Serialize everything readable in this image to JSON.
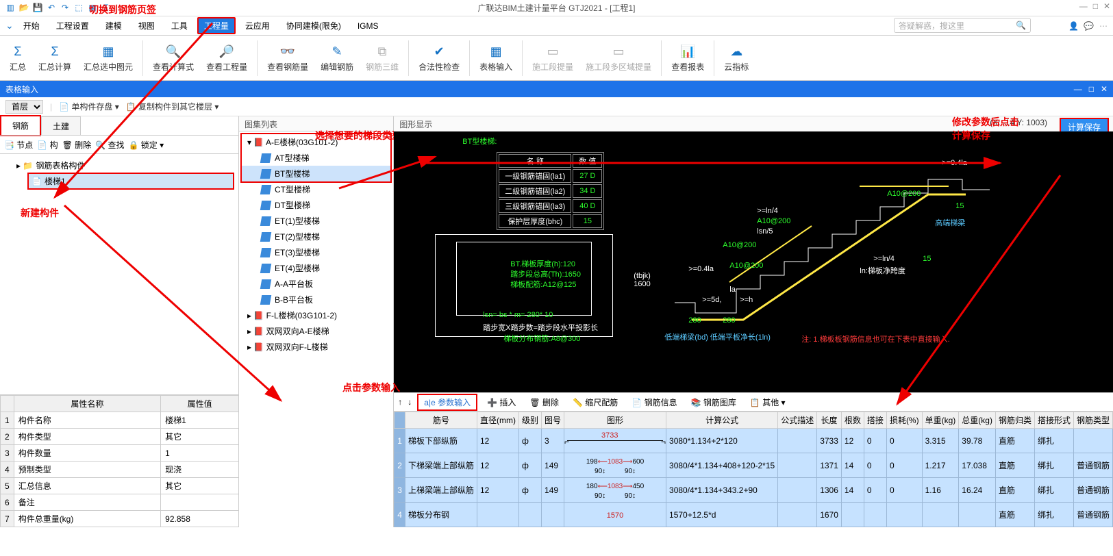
{
  "app": {
    "title": "广联达BIM土建计量平台 GTJ2021 - [工程1]"
  },
  "search": {
    "placeholder": "答疑解惑，搜这里"
  },
  "menu": [
    "开始",
    "工程设置",
    "建模",
    "视图",
    "工具",
    "工程量",
    "云应用",
    "协同建模(限免)",
    "IGMS"
  ],
  "menuActive": 5,
  "ribbon": [
    {
      "label": "汇总",
      "icon": "Σ"
    },
    {
      "label": "汇总计算",
      "icon": "Σ"
    },
    {
      "label": "汇总选中图元",
      "icon": "▦"
    },
    {
      "label": "查看计算式",
      "icon": "🔍"
    },
    {
      "label": "查看工程量",
      "icon": "📄"
    },
    {
      "label": "查看钢筋量",
      "icon": "⌗"
    },
    {
      "label": "编辑钢筋",
      "icon": "✎"
    },
    {
      "label": "钢筋三维",
      "icon": "⧉",
      "disabled": true
    },
    {
      "label": "合法性检查",
      "icon": "✔"
    },
    {
      "label": "表格输入",
      "icon": "▦"
    },
    {
      "label": "施工段提量",
      "icon": "▭",
      "disabled": true
    },
    {
      "label": "施工段多区域提量",
      "icon": "▭",
      "disabled": true
    },
    {
      "label": "查看报表",
      "icon": "📊"
    },
    {
      "label": "云指标",
      "icon": "☁"
    }
  ],
  "blueHeader": "表格输入",
  "toolbar2": {
    "floor": "首层",
    "b1": "单构件存盘 ▾",
    "b2": "复制构件到其它楼层 ▾"
  },
  "tabs": {
    "t1": "钢筋",
    "t2": "土建"
  },
  "leftToolbar": [
    "节点",
    "构",
    "删除",
    "查找",
    "锁定 ▾"
  ],
  "tree": {
    "root": "钢筋表格构件",
    "leaf": "楼梯1"
  },
  "annotations": {
    "switchTab": "切换到钢筋页签",
    "newComp": "新建构件",
    "chooseType": "选择想要的梯段类型",
    "clickParam": "点击参数输入",
    "modifySave": "修改参数后点击\n计算保存"
  },
  "midTitle": "图集列表",
  "midList": {
    "group1": "A-E楼梯(03G101-2)",
    "items1": [
      "AT型楼梯",
      "BT型楼梯",
      "CT型楼梯",
      "DT型楼梯",
      "ET(1)型楼梯",
      "ET(2)型楼梯",
      "ET(3)型楼梯",
      "ET(4)型楼梯",
      "A-A平台板",
      "B-B平台板"
    ],
    "group2": "F-L楼梯(03G101-2)",
    "group3": "双网双向A-E楼梯",
    "group4": "双网双向F-L楼梯"
  },
  "rightTitle": "图形显示",
  "coords": "(X: -14 Y: 1003)",
  "calcBtn": "计算保存",
  "diagram": {
    "title": "BT型楼梯:",
    "paramHeaders": [
      "名 称",
      "数 值"
    ],
    "params": [
      [
        "一级钢筋锚固(la1)",
        "27 D"
      ],
      [
        "二级钢筋锚固(la2)",
        "34 D"
      ],
      [
        "三级钢筋锚固(la3)",
        "40 D"
      ],
      [
        "保护层厚度(bhc)",
        "15"
      ]
    ],
    "bt_h": "BT.梯板厚度(h):120",
    "stepTotal": "踏步段总高(Th):1650",
    "stairBar": "梯板配筋:A12@125",
    "lsn": "lsn= bs * m= 280* 10",
    "stepFormula": "踏步宽X踏步数=踏步段水平投影长",
    "distBar": "梯板分布钢筋:A8@300",
    "tbjk": "(tbjk)\n1600",
    "a10_200": "A10@200",
    "lsn5": "lsn/5",
    "ln4": ">=ln/4",
    "highBeam": "高端梯梁",
    "lowBeam": "低端梯梁(bd) 低端平板净长(1ln)",
    "stairNet": "ln:梯板净跨度",
    "note": "注: 1.梯板板钢筋信息也可在下表中直接输入.",
    "la": "la",
    "h": ">=h",
    "d5": ">=5d,",
    "d04": ">=0.4la",
    "v280": "280",
    "v15": "15"
  },
  "propHeaders": [
    "属性名称",
    "属性值"
  ],
  "props": [
    [
      "构件名称",
      "楼梯1"
    ],
    [
      "构件类型",
      "其它"
    ],
    [
      "构件数量",
      "1"
    ],
    [
      "预制类型",
      "现浇"
    ],
    [
      "汇总信息",
      "其它"
    ],
    [
      "备注",
      ""
    ],
    [
      "构件总重量(kg)",
      "92.858"
    ]
  ],
  "rebarToolbar": {
    "param": "参数输入",
    "items": [
      "插入",
      "删除",
      "缩尺配筋",
      "钢筋信息",
      "钢筋图库",
      "其他 ▾"
    ]
  },
  "rebarHeaders": [
    "筋号",
    "直径(mm)",
    "级别",
    "图号",
    "图形",
    "计算公式",
    "公式描述",
    "长度",
    "根数",
    "搭接",
    "损耗(%)",
    "单重(kg)",
    "总重(kg)",
    "钢筋归类",
    "搭接形式",
    "钢筋类型"
  ],
  "rebarRows": [
    {
      "n": "1",
      "name": "梯板下部纵筋",
      "d": "12",
      "lv": "ф",
      "fig": "3",
      "shape": "3733",
      "formula": "3080*1.134+2*120",
      "desc": "",
      "len": "3733",
      "cnt": "12",
      "lap": "0",
      "loss": "0",
      "uw": "3.315",
      "tw": "39.78",
      "cls": "直筋",
      "form": "绑扎",
      "type": ""
    },
    {
      "n": "2",
      "name": "下梯梁端上部纵筋",
      "d": "12",
      "lv": "ф",
      "fig": "149",
      "shape": "198—1083—600 / 90 90",
      "formula": "3080/4*1.134+408+120-2*15",
      "desc": "",
      "len": "1371",
      "cnt": "14",
      "lap": "0",
      "loss": "0",
      "uw": "1.217",
      "tw": "17.038",
      "cls": "直筋",
      "form": "绑扎",
      "type": "普通钢筋"
    },
    {
      "n": "3",
      "name": "上梯梁端上部纵筋",
      "d": "12",
      "lv": "ф",
      "fig": "149",
      "shape": "180—1083—450 / 90 90",
      "formula": "3080/4*1.134+343.2+90",
      "desc": "",
      "len": "1306",
      "cnt": "14",
      "lap": "0",
      "loss": "0",
      "uw": "1.16",
      "tw": "16.24",
      "cls": "直筋",
      "form": "绑扎",
      "type": "普通钢筋"
    },
    {
      "n": "4",
      "name": "梯板分布钢",
      "d": "",
      "lv": "",
      "fig": "",
      "shape": "1570",
      "formula": "1570+12.5*d",
      "desc": "",
      "len": "1670",
      "cnt": "",
      "lap": "",
      "loss": "",
      "uw": "",
      "tw": "",
      "cls": "直筋",
      "form": "绑扎",
      "type": "普通钢筋"
    }
  ]
}
